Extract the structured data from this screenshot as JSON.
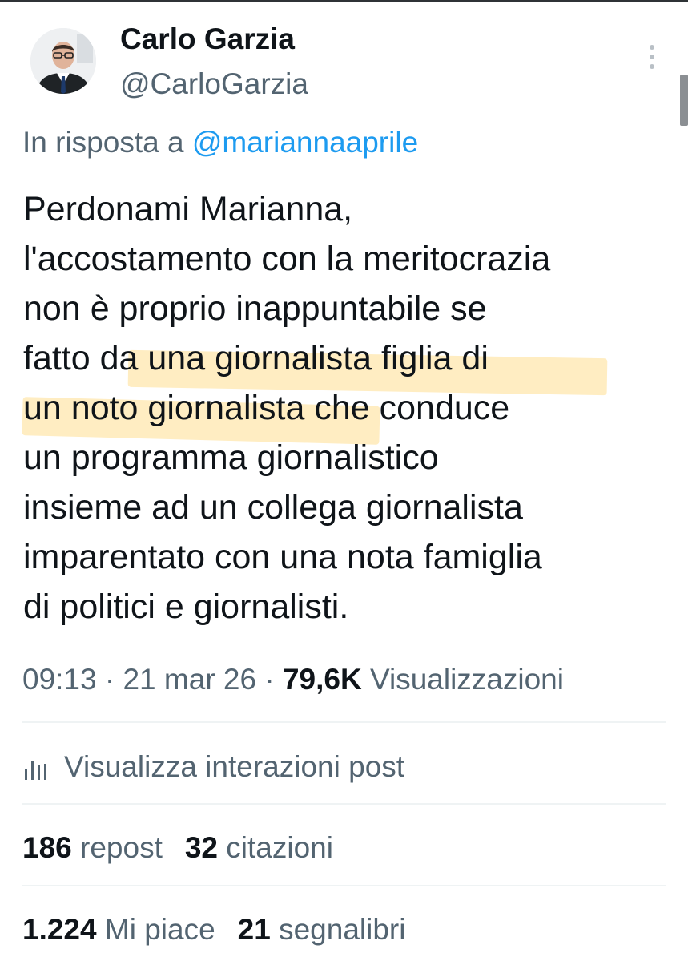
{
  "author": {
    "display_name": "Carlo Garzia",
    "handle": "@CarloGarzia"
  },
  "reply": {
    "prefix": "In risposta a ",
    "mention": "@mariannaaprile"
  },
  "tweet": {
    "lines": [
      "Perdonami Marianna,",
      "l'accostamento con la meritocrazia",
      "non è proprio inappuntabile se",
      "fatto da una giornalista figlia di",
      "un noto giornalista che conduce",
      "un programma giornalistico",
      "insieme ad un collega giornalista",
      "imparentato con una nota famiglia",
      "di politici e giornalisti."
    ],
    "highlighted_text": "da una giornalista figlia di un noto giornalista",
    "highlight_color": "#ffd56e"
  },
  "meta": {
    "time": "09:13",
    "sep1": " · ",
    "date": "21 mar 26",
    "sep2": " · ",
    "views_count": "79,6K",
    "views_label": " Visualizzazioni"
  },
  "insights": {
    "icon": "analytics-bars-icon",
    "label": "Visualizza interazioni post"
  },
  "stats": {
    "reposts_count": "186",
    "reposts_label": " repost",
    "quotes_count": "32",
    "quotes_label": " citazioni",
    "likes_count": "1.224",
    "likes_label": " Mi piace",
    "bookmarks_count": "21",
    "bookmarks_label": " segnalibri"
  },
  "colors": {
    "text": "#0f1419",
    "secondary": "#536471",
    "link": "#1d9bf0",
    "divider": "#eff3f4"
  }
}
